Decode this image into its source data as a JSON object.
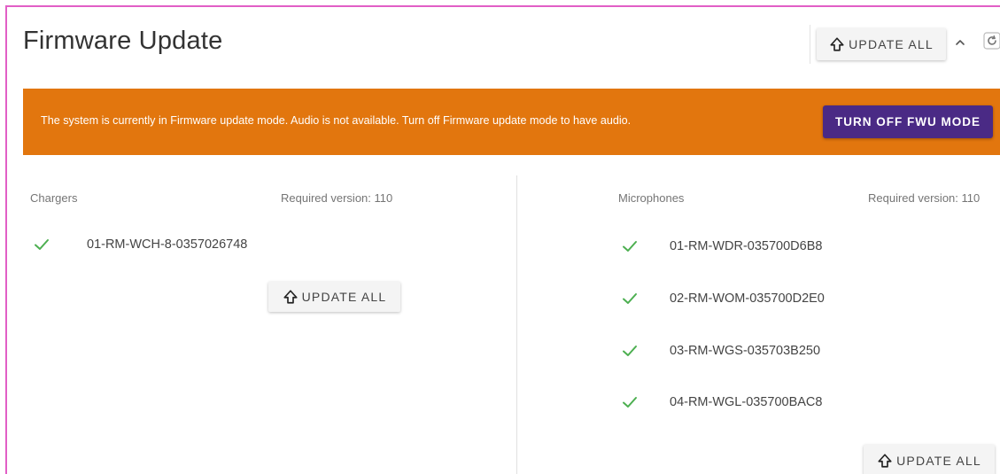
{
  "title": "Firmware Update",
  "header": {
    "update_all_label": "UPDATE ALL",
    "icons": [
      "arrow-up-outline-icon",
      "chevron-up-icon",
      "refresh-icon"
    ]
  },
  "banner": {
    "message": "The system is currently in Firmware update mode. Audio is not available. Turn off Firmware update mode to have audio.",
    "button_label": "TURN OFF FWU MODE"
  },
  "chargers": {
    "heading": "Chargers",
    "required_version": "Required version: 110",
    "devices": [
      {
        "name": "01-RM-WCH-8-0357026748",
        "status": "ok"
      }
    ],
    "update_all_label": "UPDATE ALL"
  },
  "microphones": {
    "heading": "Microphones",
    "required_version": "Required version: 110",
    "devices": [
      {
        "name": "01-RM-WDR-035700D6B8",
        "status": "ok"
      },
      {
        "name": "02-RM-WOM-035700D2E0",
        "status": "ok"
      },
      {
        "name": "03-RM-WGS-035703B250",
        "status": "ok"
      },
      {
        "name": "04-RM-WGL-035700BAC8",
        "status": "ok"
      }
    ],
    "update_all_label": "UPDATE ALL"
  },
  "colors": {
    "banner": "#e2760e",
    "banner_button": "#4a2a85",
    "check": "#4caf50",
    "frame_border": "#e25fc6"
  }
}
